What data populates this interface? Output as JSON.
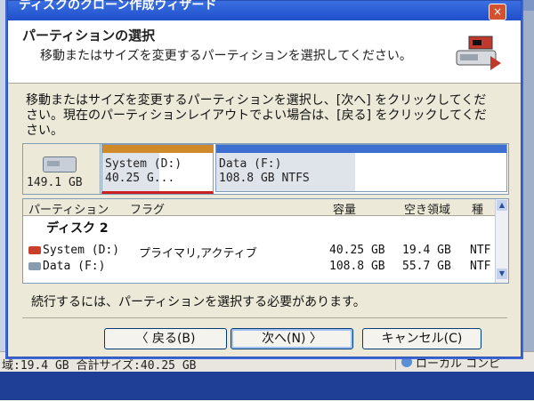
{
  "window": {
    "title": "ディスクのクローン作成ウィザード",
    "close_glyph": "×"
  },
  "header": {
    "title": "パーティションの選択",
    "subtitle": "移動またはサイズを変更するパーティションを選択してください。"
  },
  "instructions": "移動またはサイズを変更するパーティションを選択し、[次へ] をクリックしてください。現在のパーティションレイアウトでよい場合は、[戻る] をクリックしてください。",
  "disk_map": {
    "disk_size": "149.1 GB",
    "partitions": [
      {
        "line1": "System (D:)",
        "line2": "40.25 G...",
        "color": "#d08a2a",
        "used_fraction": 0.52,
        "selected": true
      },
      {
        "line1": "Data (F:)",
        "line2": "108.8 GB  NTFS",
        "color": "#3d6fd1",
        "used_fraction": 0.48,
        "selected": false
      }
    ]
  },
  "partition_list": {
    "columns": [
      "パーティション",
      "フラグ",
      "容量",
      "空き領域",
      "種"
    ],
    "disk_label": "ディスク 2",
    "rows": [
      {
        "name": "System (D:)",
        "flags": "プライマリ,アクティブ",
        "capacity": "40.25 GB",
        "free": "19.4 GB",
        "type": "NTF"
      },
      {
        "name": "Data (F:)",
        "flags": "",
        "capacity": "108.8 GB",
        "free": "55.7 GB",
        "type": "NTF"
      }
    ]
  },
  "status_message": "続行するには、パーティションを選択する必要があります。",
  "buttons": {
    "back": "〈 戻る(B)",
    "next": "次へ(N) 〉",
    "cancel": "キャンセル(C)"
  },
  "background": {
    "status_left": "域:19.4 GB 合計サイズ:40.25 GB",
    "status_right": "ローカル コンピ"
  }
}
